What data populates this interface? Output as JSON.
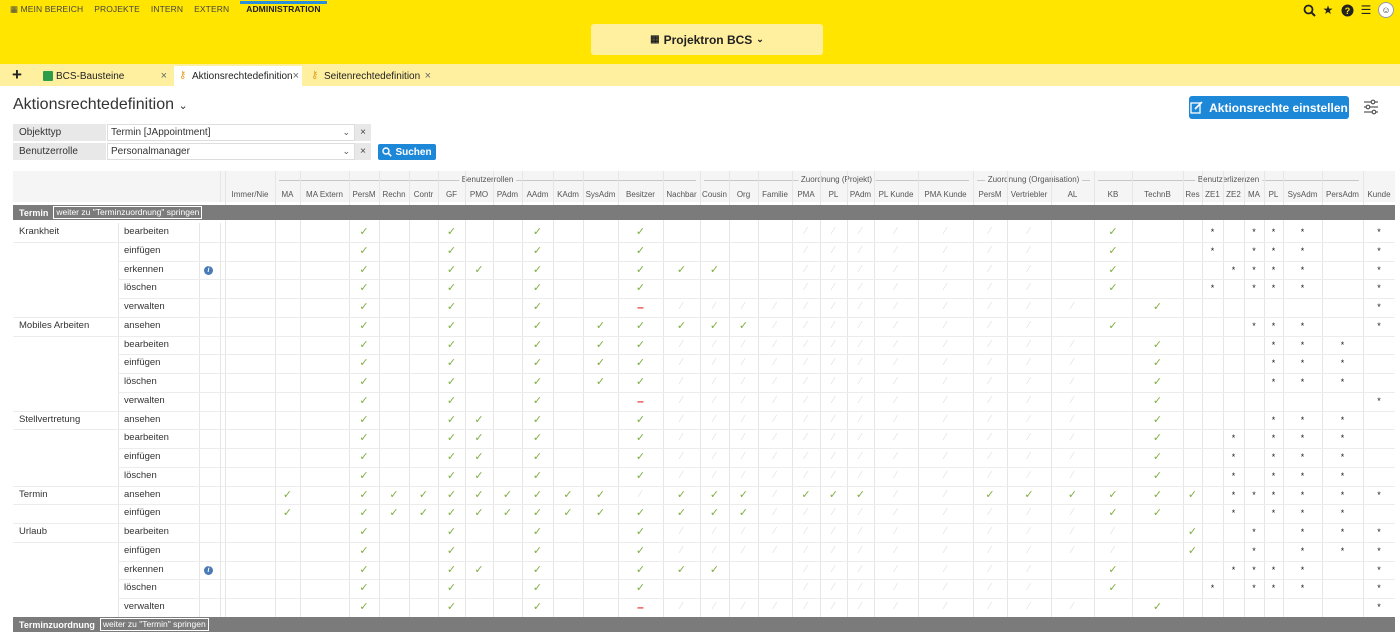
{
  "topnav": {
    "items": [
      "MEIN BEREICH",
      "PROJEKTE",
      "INTERN",
      "EXTERN"
    ],
    "active": "ADMINISTRATION"
  },
  "topicons": [
    "search-icon",
    "star-icon",
    "help-icon",
    "menu-icon",
    "avatar"
  ],
  "project_selector": "Projektron BCS",
  "tabs": {
    "items": [
      {
        "label": "BCS-Bausteine",
        "icon": "module-icon"
      },
      {
        "label": "Aktionsrechtedefinition",
        "icon": "key-icon"
      },
      {
        "label": "Seitenrechtedefinition",
        "icon": "key-icon"
      }
    ]
  },
  "page": {
    "title": "Aktionsrechtedefinition",
    "primary_button": "Aktionsrechte einstellen"
  },
  "filters": {
    "objekttyp_label": "Objekttyp",
    "objekttyp_value": "Termin [JAppointment]",
    "rolle_label": "Benutzerrolle",
    "rolle_value": "Personalmanager",
    "search_label": "Suchen"
  },
  "colors": {
    "accent": "#ffe500",
    "tab_bar": "#fff0a0",
    "primary": "#1e88d8",
    "check": "#7fae43",
    "denied": "#e53935",
    "section": "#7b7b7b"
  },
  "matrix": {
    "column_groups": [
      {
        "label": "Benutzerrollen",
        "from": 2,
        "to": 14
      },
      {
        "label": "Zuordnung (Projekt)",
        "from": 15,
        "to": 22
      },
      {
        "label": "Zuordnung (Organisation)",
        "from": 23,
        "to": 25
      },
      {
        "label": "Benutzerlizenzen",
        "from": 26,
        "to": 34
      }
    ],
    "columns": [
      "Immer/Nie",
      "MA",
      "MA Extern",
      "PersM",
      "Rechn",
      "Contr",
      "GF",
      "PMO",
      "PAdm",
      "AAdm",
      "KAdm",
      "SysAdm",
      "Besitzer",
      "Nachbar",
      "Cousin",
      "Org",
      "Familie",
      "PMA",
      "PL",
      "PAdm",
      "PL Kunde",
      "PMA Kunde",
      "PersM",
      "Vertriebler",
      "AL",
      "KB",
      "TechnB",
      "Res",
      "ZE1",
      "ZE2",
      "MA",
      "PL",
      "SysAdm",
      "PersAdm",
      "Kunde"
    ],
    "section_title": "Termin",
    "section_jump": "weiter zu \"Terminzuordnung\" springen",
    "next_section_title": "Terminzuordnung",
    "next_section_jump": "weiter zu \"Termin\" springen",
    "legend": {
      "c": "granted",
      "f": "not applicable",
      "d": "denied",
      "s": "license available",
      ".": "none"
    },
    "rows": [
      {
        "object": "Krankheit",
        "action": "bearbeiten",
        "info": false,
        "marks": "...c..c..c..c....fffffff.c..s.sss.s."
      },
      {
        "object": "",
        "action": "einfügen",
        "info": false,
        "marks": "...c..c..c..c....fffffff.c..s.sss.s."
      },
      {
        "object": "",
        "action": "erkennen",
        "info": true,
        "marks": "...c..cc.c..ccc..fffffff.c...ssss.s."
      },
      {
        "object": "",
        "action": "löschen",
        "info": false,
        "marks": "...c..c..c..c....fffffff.c..s.sss.s."
      },
      {
        "object": "",
        "action": "verwalten",
        "info": false,
        "marks": "...c..c..c..dffffffffffff.c.......s."
      },
      {
        "object": "Mobiles Arbeiten",
        "action": "ansehen",
        "info": false,
        "marks": "...c..c..c.cccccffffffff.c....sss.s."
      },
      {
        "object": "",
        "action": "bearbeiten",
        "info": false,
        "marks": "...c..c..c.ccffffffffffff.c....sss.s."
      },
      {
        "object": "",
        "action": "einfügen",
        "info": false,
        "marks": "...c..c..c.ccffffffffffff.c....sss.s."
      },
      {
        "object": "",
        "action": "löschen",
        "info": false,
        "marks": "...c..c..c.ccffffffffffff.c....sss.s."
      },
      {
        "object": "",
        "action": "verwalten",
        "info": false,
        "marks": "...c..c..c..dffffffffffff.c.......s."
      },
      {
        "object": "Stellvertretung",
        "action": "ansehen",
        "info": false,
        "marks": "...c..cc.c..cffffffffffff.c....sss.s."
      },
      {
        "object": "",
        "action": "bearbeiten",
        "info": false,
        "marks": "...c..cc.c..cffffffffffff.c..s.sss.s."
      },
      {
        "object": "",
        "action": "einfügen",
        "info": false,
        "marks": "...c..cc.c..cffffffffffff.c..s.sss.s."
      },
      {
        "object": "",
        "action": "löschen",
        "info": false,
        "marks": "...c..cc.c..cffffffffffff.c..s.sss.s."
      },
      {
        "object": "Termin",
        "action": "ansehen",
        "info": false,
        "marks": ".c.cccccccccfcccfcccffcccccc.ssssssss"
      },
      {
        "object": "",
        "action": "einfügen",
        "info": false,
        "marks": ".c.cccccccccccccfffffffffcc..s.sss.ss"
      },
      {
        "object": "Urlaub",
        "action": "bearbeiten",
        "info": false,
        "marks": "...c..c..c..cfffffffffffff.c..s.sss.s."
      },
      {
        "object": "",
        "action": "einfügen",
        "info": false,
        "marks": "...c..c..c..cfffffffffffff.c..s.sss.s."
      },
      {
        "object": "",
        "action": "erkennen",
        "info": true,
        "marks": "...c..cc.c..ccc..fffffff.c...ssss.s."
      },
      {
        "object": "",
        "action": "löschen",
        "info": false,
        "marks": "...c..c..c..c....fffffff.c..s.sss.s."
      },
      {
        "object": "",
        "action": "verwalten",
        "info": false,
        "marks": "...c..c..c..dffffffffffff.c.......s."
      }
    ]
  }
}
